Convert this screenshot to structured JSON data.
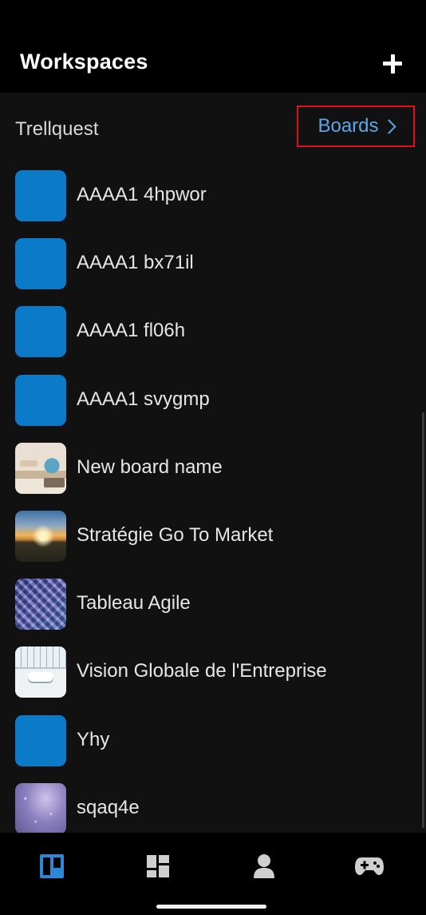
{
  "app_bar": {
    "title": "Workspaces",
    "add_icon": "plus-icon"
  },
  "workspace": {
    "name": "Trellquest",
    "boards_link_label": "Boards",
    "boards_link_icon": "chevron-right-icon",
    "highlight_color": "#e0101a"
  },
  "boards": [
    {
      "label": "AAAA1 4hpwor",
      "thumbnail": "solid-blue",
      "color": "#0a7ac9"
    },
    {
      "label": "AAAA1 bx71il",
      "thumbnail": "solid-blue",
      "color": "#0a7ac9"
    },
    {
      "label": "AAAA1 fl06h",
      "thumbnail": "solid-blue",
      "color": "#0a7ac9"
    },
    {
      "label": "AAAA1 svygmp",
      "thumbnail": "solid-blue",
      "color": "#0a7ac9"
    },
    {
      "label": "New board name",
      "thumbnail": "desk-photo"
    },
    {
      "label": "Stratégie Go To Market",
      "thumbnail": "sunset-photo"
    },
    {
      "label": "Tableau Agile",
      "thumbnail": "architecture-photo"
    },
    {
      "label": "Vision Globale de l'Entreprise",
      "thumbnail": "office-photo"
    },
    {
      "label": "Yhy",
      "thumbnail": "solid-blue",
      "color": "#0a7ac9"
    },
    {
      "label": "sqaq4e",
      "thumbnail": "cosmic-photo"
    }
  ],
  "bottom_nav": {
    "items": [
      {
        "icon": "boards-icon",
        "active": true
      },
      {
        "icon": "dashboard-icon",
        "active": false
      },
      {
        "icon": "profile-icon",
        "active": false
      },
      {
        "icon": "gamepad-icon",
        "active": false
      }
    ],
    "active_color": "#2f86d6",
    "inactive_color": "#cfcfcf"
  },
  "colors": {
    "accent": "#5aa6e6",
    "background": "#111111",
    "bar_background": "#000000"
  }
}
